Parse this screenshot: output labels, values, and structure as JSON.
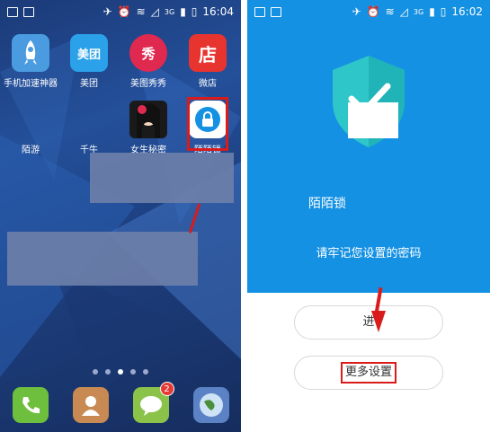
{
  "left_screen": {
    "status": {
      "time": "16:04",
      "signal_label": "3G"
    },
    "apps": [
      {
        "label": "手机加速神器",
        "icon": "rocket-icon",
        "glyph": ""
      },
      {
        "label": "美团",
        "icon": "meituan-icon",
        "glyph": "美团"
      },
      {
        "label": "美图秀秀",
        "icon": "meitu-icon",
        "glyph": "秀"
      },
      {
        "label": "微店",
        "icon": "weidian-icon",
        "glyph": "店"
      },
      {
        "label": "陌游",
        "icon": "moyou-icon",
        "glyph": ""
      },
      {
        "label": "千牛",
        "icon": "qianniu-icon",
        "glyph": ""
      },
      {
        "label": "女生秘密",
        "icon": "girl-secret-icon",
        "glyph": ""
      },
      {
        "label": "陌陌锁",
        "icon": "lock-icon",
        "glyph": ""
      }
    ],
    "dock": [
      {
        "icon": "phone-icon"
      },
      {
        "icon": "contacts-icon"
      },
      {
        "icon": "messages-icon",
        "badge": "2"
      },
      {
        "icon": "browser-icon"
      }
    ],
    "colors": {
      "highlight": "#d91b1b"
    }
  },
  "right_screen": {
    "status": {
      "time": "16:02",
      "signal_label": "3G"
    },
    "app_title": "陌陌锁",
    "subtitle": "请牢记您设置的密码",
    "enter_button": "进",
    "more_settings_button": "更多设置",
    "colors": {
      "primary": "#1591e3",
      "highlight": "#d91b1b"
    }
  }
}
